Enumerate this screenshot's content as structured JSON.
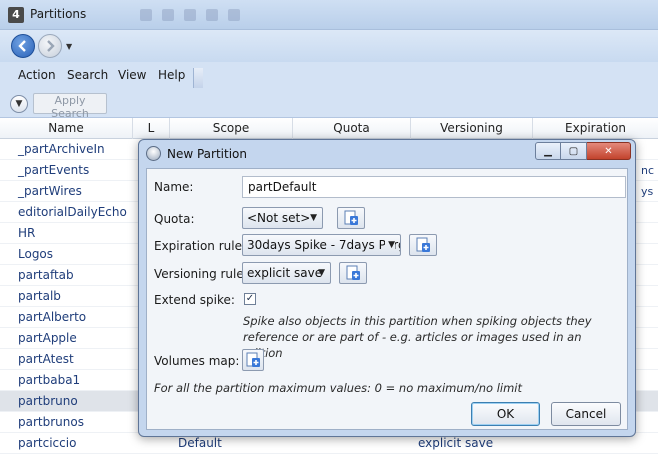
{
  "window": {
    "app_icon_text": "4",
    "title": "Partitions"
  },
  "menu": {
    "items": [
      "Action",
      "Search",
      "View",
      "Help"
    ]
  },
  "searchbar": {
    "apply_search_label": "Apply Search"
  },
  "grid": {
    "columns": [
      "Name",
      "L",
      "Scope",
      "Quota",
      "Versioning",
      "Expiration"
    ],
    "rows": [
      {
        "name": "_partArchiveIn"
      },
      {
        "name": "_partEvents",
        "edge": "nc"
      },
      {
        "name": "_partWires",
        "edge": "ys"
      },
      {
        "name": "editorialDailyEcho"
      },
      {
        "name": "HR"
      },
      {
        "name": "Logos"
      },
      {
        "name": "partaftab"
      },
      {
        "name": "partalb"
      },
      {
        "name": "partAlberto"
      },
      {
        "name": "partApple"
      },
      {
        "name": "partAtest"
      },
      {
        "name": "partbaba1"
      },
      {
        "name": "partbruno",
        "selected": true
      },
      {
        "name": "partbrunos"
      },
      {
        "name": "partciccio",
        "scope": "Default",
        "versioning": "explicit save"
      }
    ]
  },
  "dialog": {
    "title": "New Partition",
    "name_label": "Name:",
    "name_value": "partDefault",
    "quota_label": "Quota:",
    "quota_value": "<Not set>",
    "expiration_label": "Expiration rule:",
    "expiration_value": "30days Spike - 7days Purg",
    "versioning_label": "Versioning rule:",
    "versioning_value": "explicit save",
    "extend_spike_label": "Extend spike:",
    "extend_spike_checked": true,
    "extend_spike_hint": "Spike also objects in this partition when spiking objects they reference or are part of - e.g. articles or images used in an edition",
    "volumes_label": "Volumes map:",
    "footnote": "For all the partition maximum values: 0 = no maximum/no limit",
    "ok_label": "OK",
    "cancel_label": "Cancel"
  }
}
